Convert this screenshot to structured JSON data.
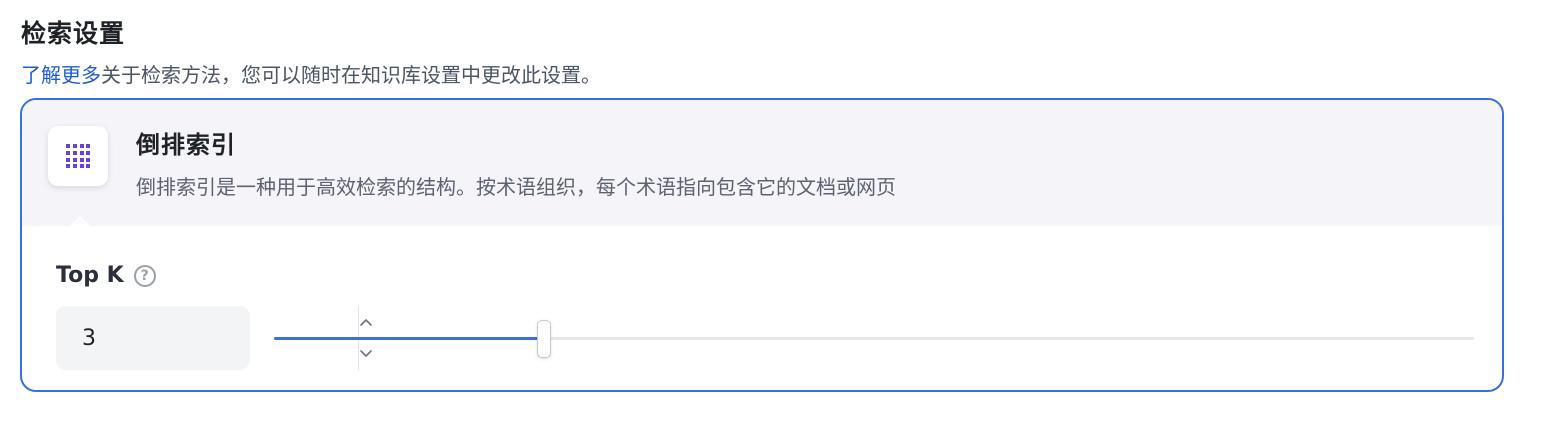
{
  "section": {
    "title": "检索设置",
    "learn_more": "了解更多",
    "description_rest": "关于检索方法，您可以随时在知识库设置中更改此设置。"
  },
  "method": {
    "icon": "grid-dots-icon",
    "title": "倒排索引",
    "description": "倒排索引是一种用于高效检索的结构。按术语组织，每个术语指向包含它的文档或网页"
  },
  "top_k": {
    "label": "Top K",
    "value": "3",
    "slider_fraction": 0.225
  },
  "colors": {
    "accent": "#3b6fe0",
    "link": "#1f5bd6",
    "icon_purple": "#6b3fe0",
    "header_bg": "#f4f4f9"
  }
}
